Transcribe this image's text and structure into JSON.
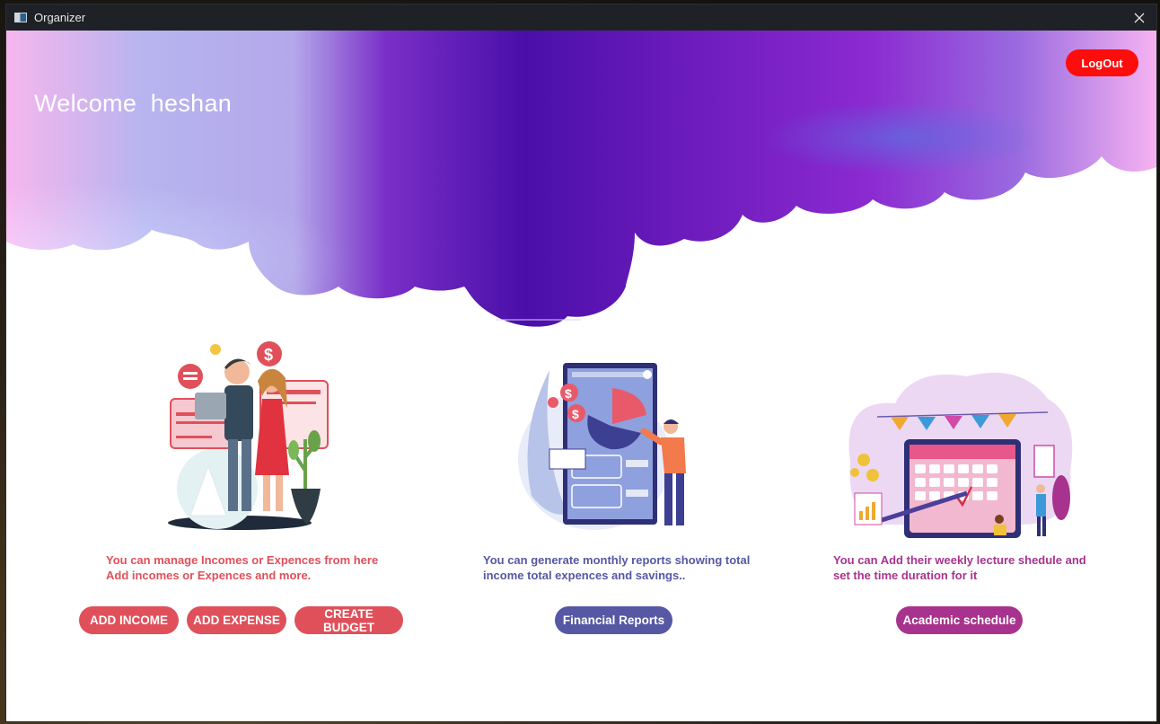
{
  "window": {
    "title": "Organizer"
  },
  "header": {
    "welcome": "Welcome  heshan",
    "logout_label": "LogOut"
  },
  "features": [
    {
      "description": [
        "You can manage Incomes or Expences from here",
        "Add incomes or Expences and more."
      ],
      "buttons": [
        "ADD INCOME",
        "ADD EXPENSE",
        "CREATE BUDGET"
      ],
      "color": "#e0505a"
    },
    {
      "description": [
        "You can generate monthly reports showing total",
        "income total expences and savings.."
      ],
      "buttons": [
        "Financial Reports"
      ],
      "color": "#5658a4"
    },
    {
      "description": [
        "You can Add their weekly lecture shedule and",
        "set the time duration for it"
      ],
      "buttons": [
        "Academic schedule"
      ],
      "color": "#a8338e"
    }
  ],
  "icons": [
    "app-window-icon",
    "close-icon",
    "people-finance-illustration",
    "financial-report-illustration",
    "calendar-schedule-illustration"
  ]
}
